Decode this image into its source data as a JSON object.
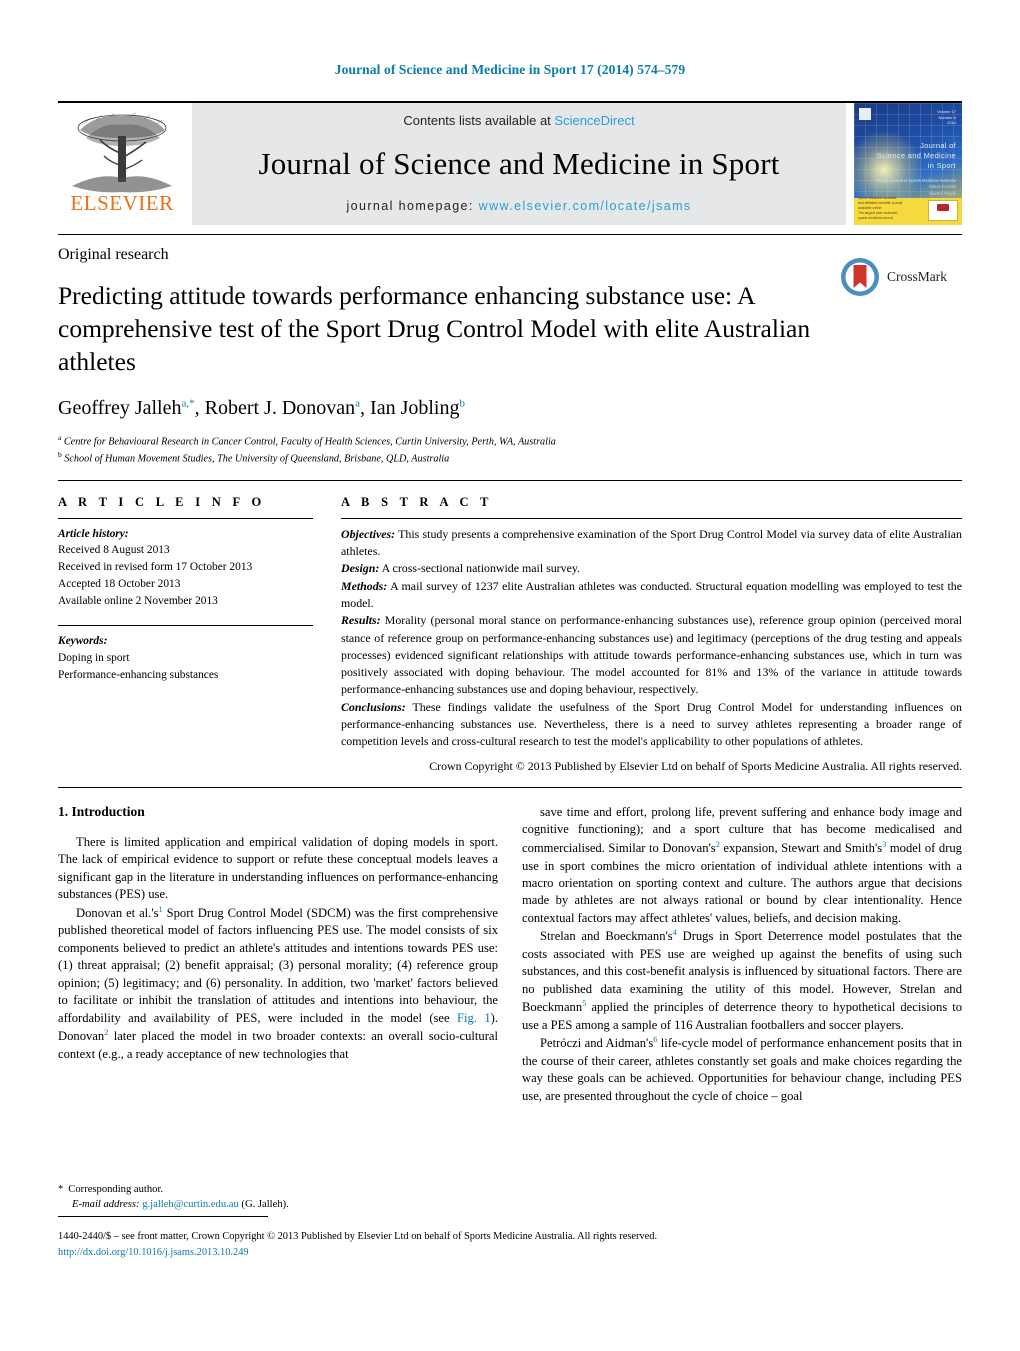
{
  "running_head": "Journal of Science and Medicine in Sport 17 (2014) 574–579",
  "masthead": {
    "publisher_name": "ELSEVIER",
    "contents_prefix": "Contents lists available at ",
    "contents_link": "ScienceDirect",
    "journal_title": "Journal of Science and Medicine in Sport",
    "homepage_prefix": "journal homepage: ",
    "homepage_url": "www.elsevier.com/locate/jsams",
    "cover": {
      "title": "Journal of\nScience and Medicine\nin Sport",
      "subtitle": "Official Journal of Sports Medicine Australia\nEditor-in-Chief\nWarren Payne\nwww.elsevier.com/locate/jsams",
      "top_right": "Volume 17\nNumber 6\n2014",
      "band_text": "Sports Medicine Australia\nand affiliated scientific journal\navailable online\nThe largest peer-reviewed\nsports medicine journal"
    }
  },
  "article": {
    "type": "Original research",
    "title": "Predicting attitude towards performance enhancing substance use: A comprehensive test of the Sport Drug Control Model with elite Australian athletes",
    "authors": [
      {
        "name": "Geoffrey Jalleh",
        "marks": "a,*"
      },
      {
        "name": "Robert J. Donovan",
        "marks": "a"
      },
      {
        "name": "Ian Jobling",
        "marks": "b"
      }
    ],
    "affiliations": [
      {
        "mark": "a",
        "text": "Centre for Behavioural Research in Cancer Control, Faculty of Health Sciences, Curtin University, Perth, WA, Australia"
      },
      {
        "mark": "b",
        "text": "School of Human Movement Studies, The University of Queensland, Brisbane, QLD, Australia"
      }
    ],
    "crossmark_label": "CrossMark"
  },
  "article_info": {
    "section_label": "A R T I C L E  I N F O",
    "history_label": "Article history:",
    "history": [
      "Received 8 August 2013",
      "Received in revised form 17 October 2013",
      "Accepted 18 October 2013",
      "Available online 2 November 2013"
    ],
    "keywords_label": "Keywords:",
    "keywords": [
      "Doping in sport",
      "Performance-enhancing substances"
    ]
  },
  "abstract": {
    "section_label": "A B S T R A C T",
    "objectives_label": "Objectives:",
    "objectives": " This study presents a comprehensive examination of the Sport Drug Control Model via survey data of elite Australian athletes.",
    "design_label": "Design:",
    "design": " A cross-sectional nationwide mail survey.",
    "methods_label": "Methods:",
    "methods": " A mail survey of 1237 elite Australian athletes was conducted. Structural equation modelling was employed to test the model.",
    "results_label": "Results:",
    "results": " Morality (personal moral stance on performance-enhancing substances use), reference group opinion (perceived moral stance of reference group on performance-enhancing substances use) and legitimacy (perceptions of the drug testing and appeals processes) evidenced significant relationships with attitude towards performance-enhancing substances use, which in turn was positively associated with doping behaviour. The model accounted for 81% and 13% of the variance in attitude towards performance-enhancing substances use and doping behaviour, respectively.",
    "conclusions_label": "Conclusions:",
    "conclusions": " These findings validate the usefulness of the Sport Drug Control Model for understanding influences on performance-enhancing substances use. Nevertheless, there is a need to survey athletes representing a broader range of competition levels and cross-cultural research to test the model's applicability to other populations of athletes.",
    "copyright": "Crown Copyright © 2013 Published by Elsevier Ltd on behalf of Sports Medicine Australia. All rights reserved."
  },
  "body": {
    "section_heading": "1.  Introduction",
    "left_col": [
      "There is limited application and empirical validation of doping models in sport. The lack of empirical evidence to support or refute these conceptual models leaves a significant gap in the literature in understanding influences on performance-enhancing substances (PES) use.",
      "Donovan et al.'s<sup>1</sup> Sport Drug Control Model (SDCM) was the first comprehensive published theoretical model of factors influencing PES use. The model consists of six components believed to predict an athlete's attitudes and intentions towards PES use: (1) threat appraisal; (2) benefit appraisal; (3) personal morality; (4) reference group opinion; (5) legitimacy; and (6) personality. In addition, two 'market' factors believed to facilitate or inhibit the translation of attitudes and intentions into behaviour, the affordability and availability of PES, were included in the model (see <span class=\"figref\">Fig. 1</span>). Donovan<sup>2</sup> later placed the model in two broader contexts: an overall socio-cultural context (e.g., a ready acceptance of new technologies that"
    ],
    "right_col": [
      "save time and effort, prolong life, prevent suffering and enhance body image and cognitive functioning); and a sport culture that has become medicalised and commercialised. Similar to Donovan's<sup>2</sup> expansion, Stewart and Smith's<sup>3</sup> model of drug use in sport combines the micro orientation of individual athlete intentions with a macro orientation on sporting context and culture. The authors argue that decisions made by athletes are not always rational or bound by clear intentionality. Hence contextual factors may affect athletes' values, beliefs, and decision making.",
      "Strelan and Boeckmann's<sup>4</sup> Drugs in Sport Deterrence model postulates that the costs associated with PES use are weighed up against the benefits of using such substances, and this cost-benefit analysis is influenced by situational factors. There are no published data examining the utility of this model. However, Strelan and Boeckmann<sup>5</sup> applied the principles of deterrence theory to hypothetical decisions to use a PES among a sample of 116 Australian footballers and soccer players.",
      "Petróczi and Aidman's<sup>6</sup> life-cycle model of performance enhancement posits that in the course of their career, athletes constantly set goals and make choices regarding the way these goals can be achieved. Opportunities for behaviour change, including PES use, are presented throughout the cycle of choice – goal"
    ]
  },
  "footer": {
    "corresponding_marker": "*",
    "corresponding_label": "Corresponding author.",
    "email_label": "E-mail address:",
    "email": "g.jalleh@curtin.edu.au",
    "email_suffix": " (G. Jalleh).",
    "imprint": "1440-2440/$ – see front matter, Crown Copyright © 2013 Published by Elsevier Ltd on behalf of Sports Medicine Australia. All rights reserved.",
    "doi": "http://dx.doi.org/10.1016/j.jsams.2013.10.249"
  },
  "colors": {
    "link": "#0b7ba8",
    "sciencedirect": "#2b9fd4",
    "elsevier_orange": "#E8711A",
    "masthead_bg": "#e6e7e8"
  }
}
